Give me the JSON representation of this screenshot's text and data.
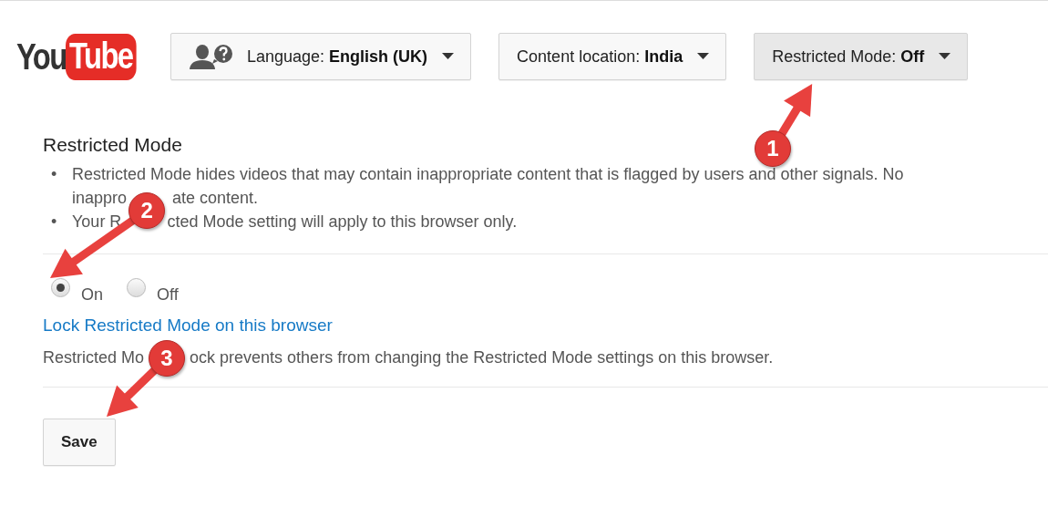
{
  "logo": {
    "word": "You",
    "badge": "Tube"
  },
  "header_buttons": [
    {
      "kind": "language",
      "label": "Language: **English (UK)**",
      "pressed": false
    },
    {
      "kind": "plain",
      "label": "Content location: **India**",
      "pressed": false
    },
    {
      "kind": "plain",
      "label": "Restricted Mode: **Off**",
      "pressed": true
    }
  ],
  "section": {
    "title": "Restricted Mode",
    "bullets": [
      {
        "marker": "•",
        "lines": [
          {
            "segments": [
              "Restricted Mode hides videos that may contain inappropriate content that is flagged by users and other signals. No"
            ]
          },
          {
            "segments": [
              "inappro",
              "ate content."
            ]
          }
        ]
      },
      {
        "marker": "•",
        "lines": [
          {
            "segments": [
              "Your R",
              "cted Mode setting will apply to this browser only."
            ]
          }
        ]
      }
    ],
    "options": [
      {
        "label": "On",
        "selected": true
      },
      {
        "label": "Off",
        "selected": false
      }
    ],
    "lock_link": "Lock Restricted Mode on this browser",
    "lock_description": [
      "Restricted Mo",
      "ock prevents others from changing the Restricted Mode settings on this browser."
    ],
    "save_button": "Save"
  },
  "annotations": [
    {
      "label": "1"
    },
    {
      "label": "2"
    },
    {
      "label": "3"
    }
  ]
}
